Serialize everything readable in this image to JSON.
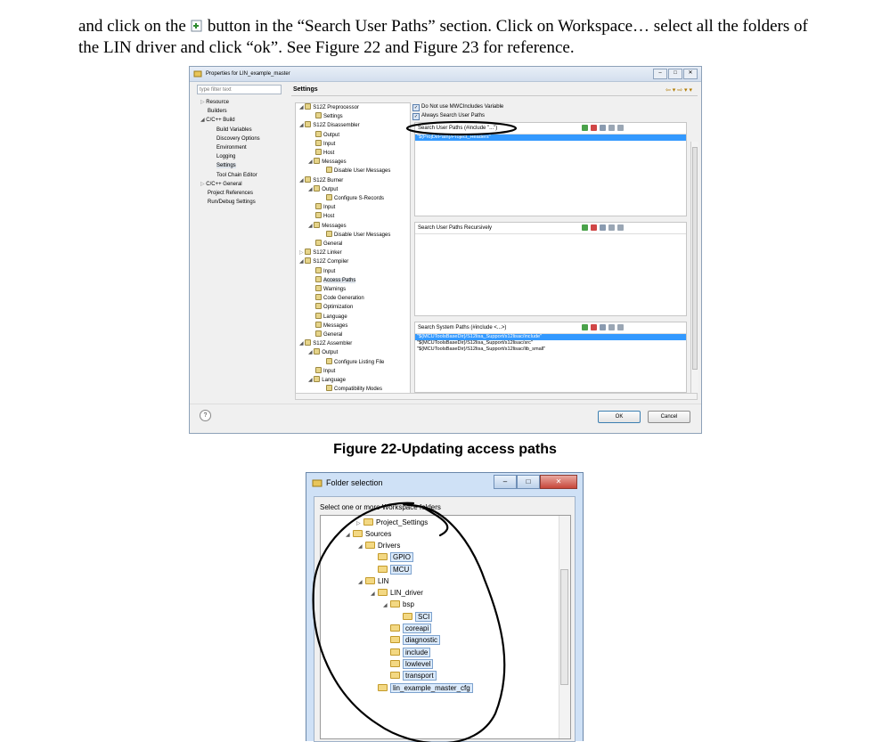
{
  "paragraph": {
    "part1": "and click on the",
    "part2": "button in the “Search User Paths” section. Click on Workspace… select all the folders of the LIN driver and click “ok”. See Figure 22 and Figure 23 for reference."
  },
  "figure_caption": "Figure 22-Updating access paths",
  "dialog1": {
    "title": "Properties for LIN_example_master",
    "filter_placeholder": "type filter text",
    "left_tree": [
      "Resource",
      "Builders",
      "C/C++ Build",
      "Build Variables",
      "Discovery Options",
      "Environment",
      "Logging",
      "Settings",
      "Tool Chain Editor",
      "C/C++ General",
      "Project References",
      "Run/Debug Settings"
    ],
    "settings_heading": "Settings",
    "mid_tree": [
      "S12Z Preprocessor",
      "Settings",
      "S12Z Disassembler",
      "Output",
      "Input",
      "Host",
      "Messages",
      "Disable User Messages",
      "S12Z Burner",
      "Output",
      "Configure S-Records",
      "Input",
      "Host",
      "Messages",
      "Disable User Messages",
      "General",
      "S12Z Linker",
      "S12Z Compiler",
      "Input",
      "Access Paths",
      "Warnings",
      "Code Generation",
      "Optimization",
      "Language",
      "Messages",
      "General",
      "S12Z Assembler",
      "Output",
      "Configure Listing File",
      "Input",
      "Language",
      "Compatibility Modes"
    ],
    "check1": "Do Not use MWCIncludes Variable",
    "check2": "Always Search User Paths",
    "user_paths_title": "Search User Paths (#include \"...\")",
    "user_paths": [
      "\"${ProjDirPath}/Project_Headers\""
    ],
    "recursive_title": "Search User Paths Recursively",
    "system_paths_title": "Search System Paths (#include <...>)",
    "system_paths": [
      "\"${MCUToolsBaseDir}/S12lisa_Support/s12lisac/include\"",
      "\"${MCUToolsBaseDir}/S12lisa_Support/s12lisac/src\"",
      "\"${MCUToolsBaseDir}/S12lisa_Support/s12lisac/lib_small\""
    ],
    "ok": "OK",
    "cancel": "Cancel",
    "help": "?"
  },
  "dialog2": {
    "title": "Folder selection",
    "instruction": "Select one or more Workspace folders",
    "nodes": [
      "Project_Settings",
      "Sources",
      "Drivers",
      "GPIO",
      "MCU",
      "LIN",
      "LIN_driver",
      "bsp",
      "SCI",
      "coreapi",
      "diagnostic",
      "include",
      "lowlevel",
      "transport",
      "lin_example_master_cfg"
    ]
  }
}
